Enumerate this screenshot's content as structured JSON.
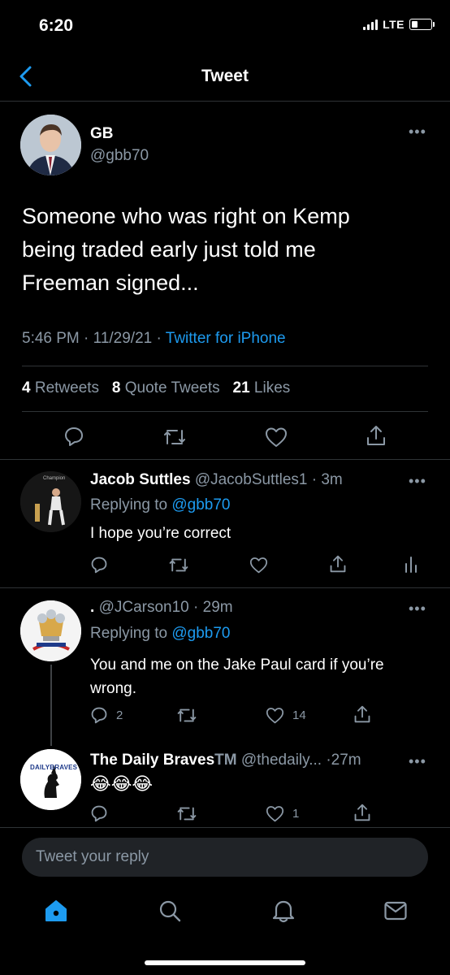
{
  "status": {
    "time": "6:20",
    "network": "LTE"
  },
  "nav": {
    "title": "Tweet"
  },
  "main_tweet": {
    "name": "GB",
    "handle": "@gbb70",
    "text_line1": "Someone who was right on Kemp",
    "text_line2": "being traded early just told me",
    "text_line3": "Freeman signed...",
    "time": "5:46 PM",
    "date": "11/29/21",
    "source": "Twitter for iPhone",
    "retweets_count": "4",
    "retweets_label": "Retweets",
    "quotes_count": "8",
    "quotes_label": "Quote Tweets",
    "likes_count": "21",
    "likes_label": "Likes"
  },
  "replies": [
    {
      "name": "Jacob Suttles",
      "handle": "@JacobSuttles1",
      "time": "3m",
      "replying_prefix": "Replying to",
      "replying_handle": "@gbb70",
      "text": "I hope you’re correct",
      "avatar_caption": "Champion"
    },
    {
      "name": ".",
      "handle": "@JCarson10",
      "time": "29m",
      "replying_prefix": "Replying to",
      "replying_handle": "@gbb70",
      "text_line1": "You and me on the Jake Paul card if you’re",
      "text_line2": "wrong.",
      "reply_count": "2",
      "like_count": "14"
    },
    {
      "name": "The Daily Braves",
      "badge": "TM",
      "handle": "@thedaily...",
      "time": "27m",
      "text": "😂😂😂",
      "like_count": "1",
      "avatar_text": "DAILYBRAVES"
    }
  ],
  "compose": {
    "placeholder": "Tweet your reply"
  },
  "colors": {
    "accent": "#1d9bf0",
    "secondary": "#8b98a5",
    "divider": "#2f3336",
    "background": "#000000"
  },
  "icons": [
    "back-chevron-icon",
    "more-icon",
    "reply-icon",
    "retweet-icon",
    "like-icon",
    "share-icon",
    "analytics-icon",
    "home-icon",
    "search-icon",
    "notifications-icon",
    "messages-icon"
  ]
}
